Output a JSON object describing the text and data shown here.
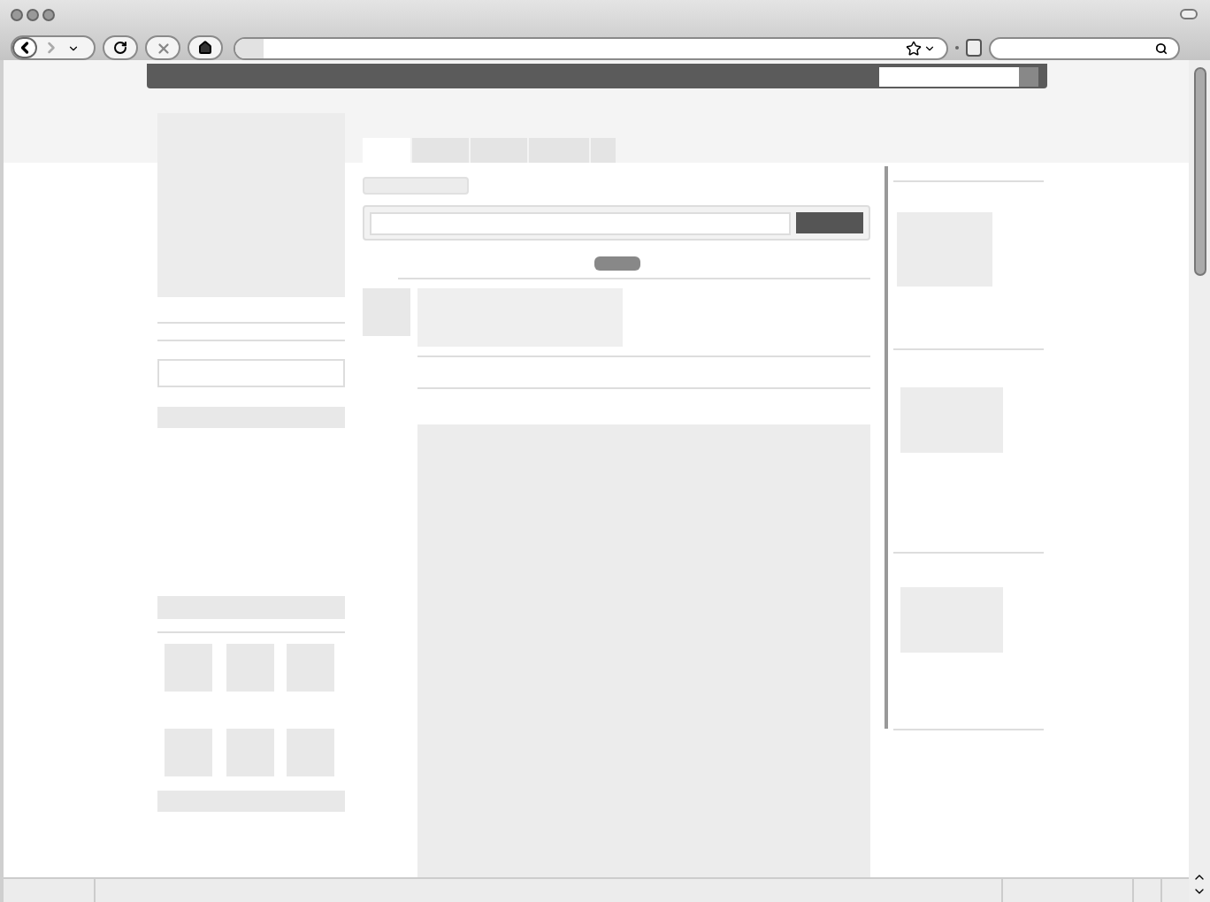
{
  "profile_tabs": [
    {
      "selected": true
    },
    {
      "selected": false
    },
    {
      "selected": false
    },
    {
      "selected": false
    },
    {
      "selected": false
    }
  ]
}
